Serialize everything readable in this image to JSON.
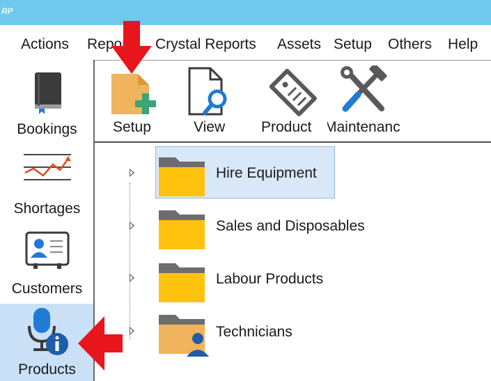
{
  "titlebar": {
    "logo": "RP"
  },
  "menu": {
    "items": [
      {
        "label": "Actions"
      },
      {
        "label": "Reports"
      },
      {
        "label": "Crystal Reports"
      },
      {
        "label": "Assets"
      },
      {
        "label": "Setup"
      },
      {
        "label": "Others"
      },
      {
        "label": "Help"
      }
    ]
  },
  "sidebar": {
    "items": [
      {
        "label": "Bookings",
        "icon": "book-icon"
      },
      {
        "label": "Shortages",
        "icon": "line-chart-icon"
      },
      {
        "label": "Customers",
        "icon": "contact-card-icon"
      },
      {
        "label": "Products",
        "icon": "microphone-info-icon",
        "selected": true
      }
    ]
  },
  "ribbon": {
    "buttons": [
      {
        "label": "Setup",
        "icon": "new-document-plus-icon"
      },
      {
        "label": "View",
        "icon": "document-search-icon"
      },
      {
        "label": "Product",
        "icon": "price-tag-icon"
      },
      {
        "label": "Maintenanc",
        "icon": "wrench-hammer-icon"
      }
    ]
  },
  "tree": {
    "nodes": [
      {
        "label": "Hire Equipment",
        "icon": "folder-icon",
        "selected": true
      },
      {
        "label": "Sales and Disposables",
        "icon": "folder-icon"
      },
      {
        "label": "Labour Products",
        "icon": "folder-icon"
      },
      {
        "label": "Technicians",
        "icon": "folder-user-icon"
      }
    ]
  },
  "colors": {
    "titlebar": "#6ec9ec",
    "selection": "#d9e8f8",
    "nav_selected": "#c9e0f7",
    "folder_yellow": "#ffc20e",
    "folder_tab": "#6d6d6d",
    "annotation_red": "#e8161c"
  }
}
